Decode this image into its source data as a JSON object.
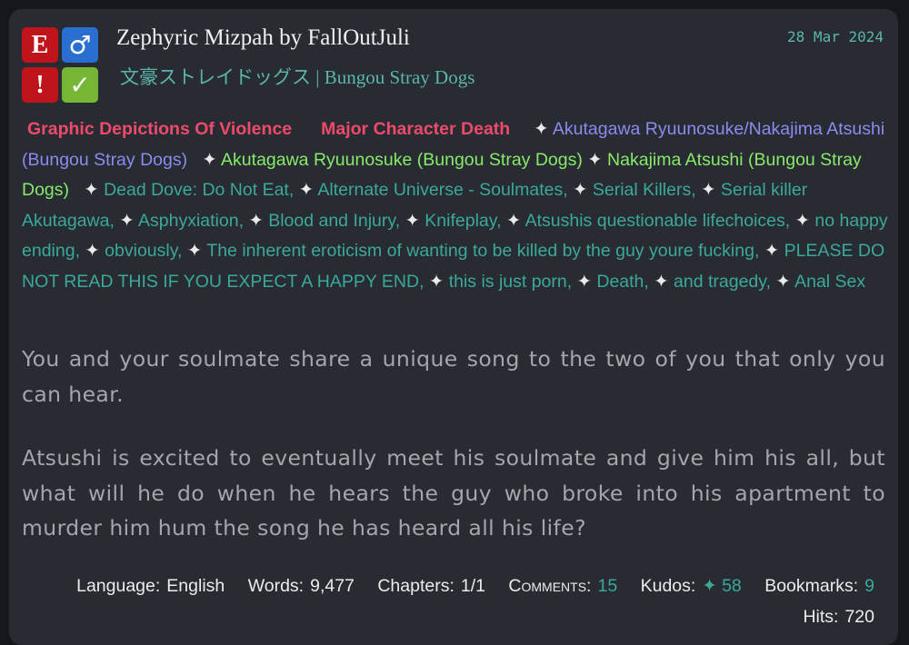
{
  "work": {
    "title_line": "Zephyric Mizpah by FallOutJuli",
    "fandom": "文豪ストレイドッグス | Bungou Stray Dogs",
    "date": "28 Mar 2024",
    "symbols": {
      "rating": "E",
      "category": "♂",
      "warning": "!",
      "complete": "✓"
    }
  },
  "tags": {
    "warnings": [
      "Graphic Depictions Of Violence",
      "Major Character Death"
    ],
    "relationships": [
      "Akutagawa Ryuunosuke/Nakajima Atsushi (Bungou Stray Dogs)"
    ],
    "characters": [
      "Akutagawa Ryuunosuke (Bungou Stray Dogs)",
      "Nakajima Atsushi (Bungou Stray Dogs)"
    ],
    "freeforms": [
      "Dead Dove: Do Not Eat",
      "Alternate Universe - Soulmates",
      "Serial Killers",
      "Serial killer Akutagawa",
      "Asphyxiation",
      "Blood and Injury",
      "Knifeplay",
      "Atsushis questionable lifechoices",
      "no happy ending",
      "obviously",
      "The inherent eroticism of wanting to be killed by the guy youre fucking",
      "PLEASE DO NOT READ THIS IF YOU EXPECT A HAPPY END",
      "this is just porn",
      "Death",
      "and tragedy",
      "Anal Sex"
    ],
    "star": "✦",
    "separator": ","
  },
  "summary": {
    "p1": "You and your soulmate share a unique song to the two of you that only you can hear.",
    "p2": "Atsushi is excited to eventually meet his soulmate and give him his all, but what will he do when he hears the guy who broke into his apartment to murder him hum the song he has heard all his life?"
  },
  "stats": {
    "language_label": "Language:",
    "language": "English",
    "words_label": "Words:",
    "words": "9,477",
    "chapters_label": "Chapters:",
    "chapters": "1/1",
    "comments_label": "Comments:",
    "comments": "15",
    "kudos_label": "Kudos:",
    "kudos": "✦ 58",
    "bookmarks_label": "Bookmarks:",
    "bookmarks": "9",
    "hits_label": "Hits:",
    "hits": "720"
  },
  "colors": {
    "background": "#15171c",
    "card": "#282b31",
    "teal": "#3aa99b",
    "warning": "#ef4a6b",
    "relationship": "#8d8af0",
    "character": "#88ea6a",
    "rating_red": "#c0141c",
    "category_blue": "#2a6fd0",
    "complete_green": "#76b536"
  }
}
